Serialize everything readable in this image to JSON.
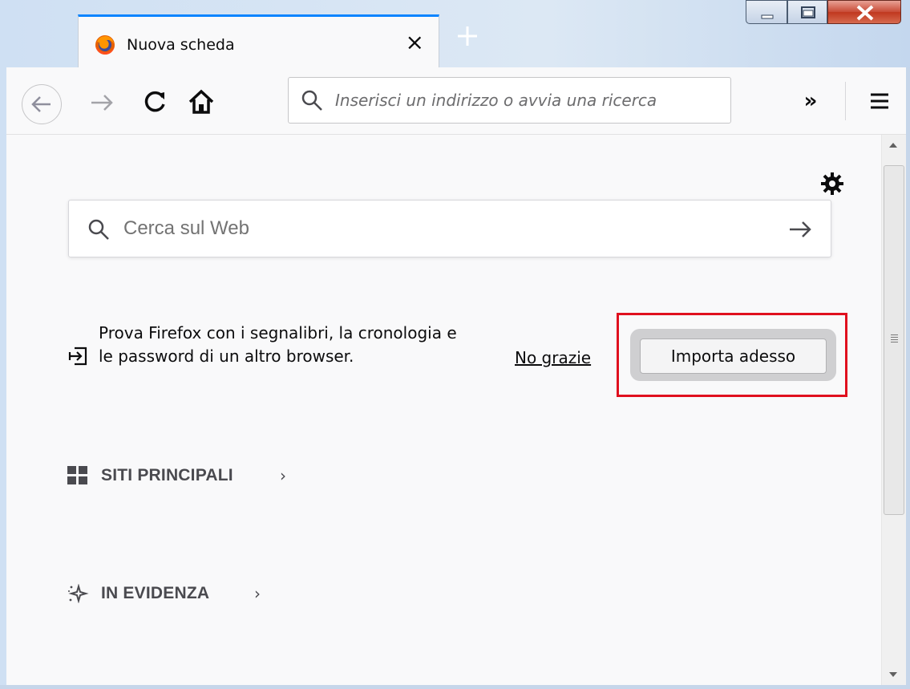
{
  "tab": {
    "title": "Nuova scheda",
    "close": "×"
  },
  "navbar": {
    "url_placeholder": "Inserisci un indirizzo o avvia una ricerca",
    "overflow": "»"
  },
  "content": {
    "search_placeholder": "Cerca sul Web",
    "import": {
      "message": "Prova Firefox con i segnalibri, la cronologia e le password di un altro browser.",
      "dismiss_label": "No grazie",
      "import_label": "Importa adesso"
    },
    "sections": [
      {
        "label": "SITI PRINCIPALI",
        "chevron": "›"
      },
      {
        "label": "IN EVIDENZA",
        "chevron": "›"
      }
    ]
  },
  "icons": {
    "favicon": "firefox-logo-icon",
    "back": "back-arrow-icon",
    "forward": "forward-arrow-icon",
    "reload": "reload-icon",
    "home": "home-icon",
    "search": "search-icon",
    "menu": "hamburger-menu-icon",
    "settings": "gear-icon",
    "import": "import-icon",
    "top_sites": "grid-icon",
    "highlights": "sparkle-icon"
  },
  "colors": {
    "accent": "#0a84ff",
    "highlight_border": "#e0101e",
    "page_bg": "#f9f9fa"
  }
}
